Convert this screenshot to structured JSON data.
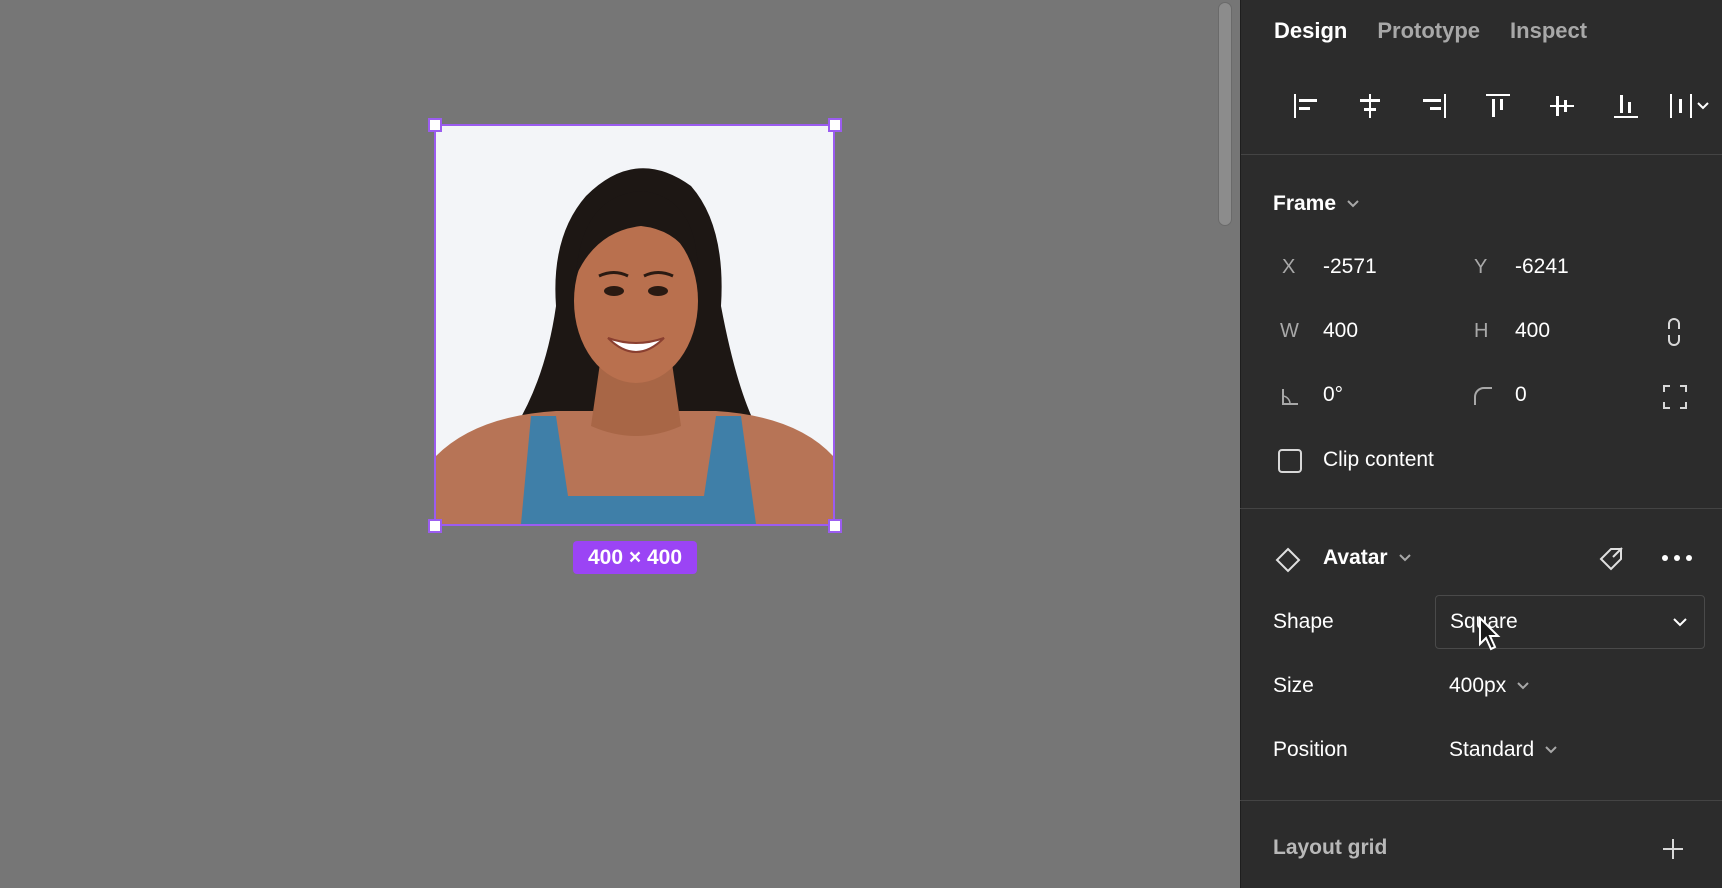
{
  "tabs": [
    "Design",
    "Prototype",
    "Inspect"
  ],
  "active_tab": "Design",
  "canvas": {
    "dimension_badge": "400 × 400",
    "selection_color": "#9b5cf0",
    "photo_alt": "woman-portrait-photo"
  },
  "frame_section": {
    "title": "Frame",
    "x_label": "X",
    "x_value": "-2571",
    "y_label": "Y",
    "y_value": "-6241",
    "w_label": "W",
    "w_value": "400",
    "h_label": "H",
    "h_value": "400",
    "rotation_value": "0°",
    "radius_value": "0",
    "clip_content_label": "Clip content",
    "clip_content_checked": false
  },
  "component_section": {
    "title": "Avatar",
    "shape_label": "Shape",
    "shape_value": "Square",
    "size_label": "Size",
    "size_value": "400px",
    "position_label": "Position",
    "position_value": "Standard"
  },
  "layout_grid": {
    "title": "Layout grid"
  },
  "colors": {
    "panel_bg": "#2c2c2c",
    "canvas_bg": "#767676",
    "accent": "#9b44f5"
  }
}
